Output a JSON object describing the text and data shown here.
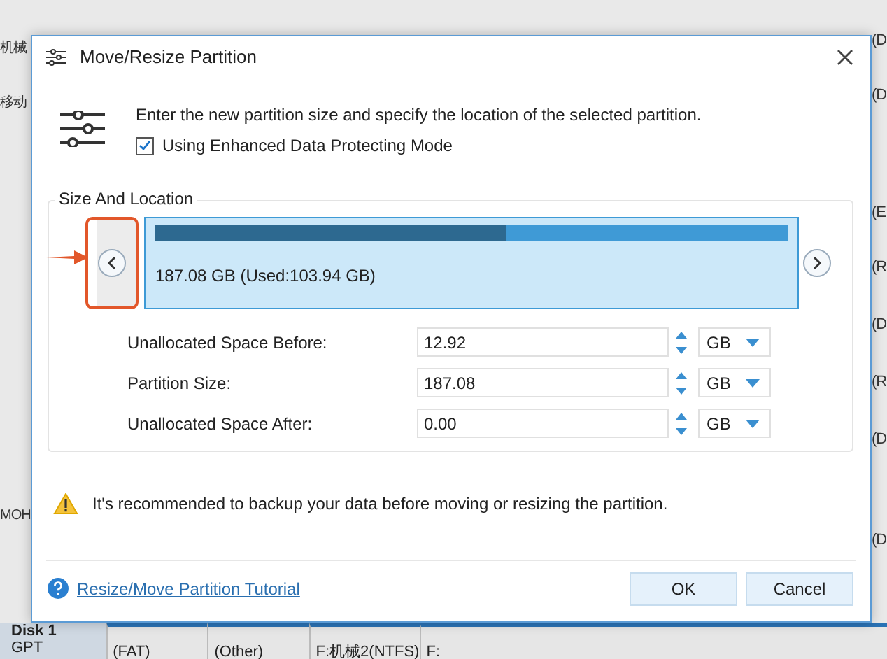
{
  "background": {
    "left_labels": [
      "机械",
      "移动",
      "MOH"
    ],
    "disk": {
      "name": "Disk 1",
      "type": "GPT"
    },
    "bottom_labels": [
      "(FAT)",
      "(Other)",
      "F:机械2(NTFS)",
      "F:"
    ],
    "right_labels": [
      "(D",
      "(D",
      "(E",
      "(R",
      "(D",
      "(R",
      "(D",
      "(D"
    ]
  },
  "dialog": {
    "title": "Move/Resize Partition",
    "description": "Enter the new partition size and specify the location of the selected partition.",
    "enhanced_mode": {
      "label": "Using Enhanced Data Protecting Mode",
      "checked": true
    },
    "section_title": "Size And Location",
    "partition": {
      "label": "187.08 GB (Used:103.94 GB)",
      "level": 0.556
    },
    "fields": [
      {
        "label": "Unallocated Space Before:",
        "value": "12.92",
        "unit": "GB"
      },
      {
        "label": "Partition Size:",
        "value": "187.08",
        "unit": "GB"
      },
      {
        "label": "Unallocated Space After:",
        "value": "0.00",
        "unit": "GB"
      }
    ],
    "warning": "It's recommended to backup your data before moving or resizing the partition.",
    "tutorial_link": "Resize/Move Partition Tutorial",
    "buttons": [
      {
        "label": "OK"
      },
      {
        "label": "Cancel"
      }
    ]
  }
}
